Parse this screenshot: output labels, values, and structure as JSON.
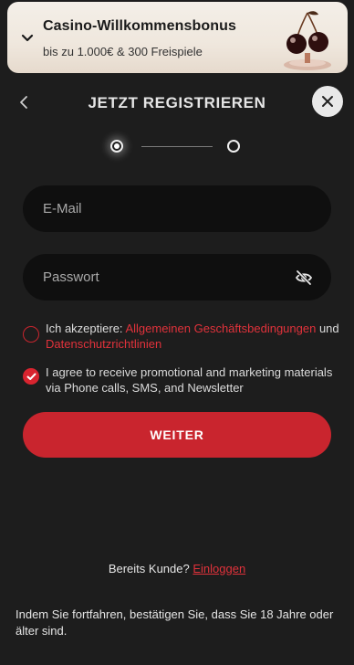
{
  "banner": {
    "title": "Casino-Willkommensbonus",
    "subtitle": "bis zu 1.000€ & 300 Freispiele",
    "expand_icon": "chevron-down-icon",
    "image": "cherries-on-stand"
  },
  "header": {
    "title": "JETZT REGISTRIEREN",
    "back_icon": "chevron-left-icon",
    "close_icon": "close-icon"
  },
  "stepper": {
    "current_step": 1,
    "total_steps": 2
  },
  "form": {
    "email_placeholder": "E-Mail",
    "password_placeholder": "Passwort",
    "password_toggle_icon": "eye-slash-icon"
  },
  "consent": {
    "terms": {
      "checked": false,
      "prefix": "Ich akzeptiere: ",
      "link1": "Allgemeinen Geschäftsbedingungen",
      "middle": " und ",
      "link2": "Datenschutzrichtlinien"
    },
    "marketing": {
      "checked": true,
      "text": "I agree to receive promotional and marketing materials via Phone calls, SMS, and Newsletter"
    }
  },
  "submit_label": "WEITER",
  "login": {
    "prompt": "Bereits Kunde? ",
    "link": "Einloggen"
  },
  "footer_text": "Indem Sie fortfahren, bestätigen Sie, dass Sie 18 Jahre oder älter sind.",
  "colors": {
    "background": "#1d1d1d",
    "accent": "#c9252e",
    "field_bg": "#0f0f0f",
    "banner_bg": "#f2ece4"
  }
}
